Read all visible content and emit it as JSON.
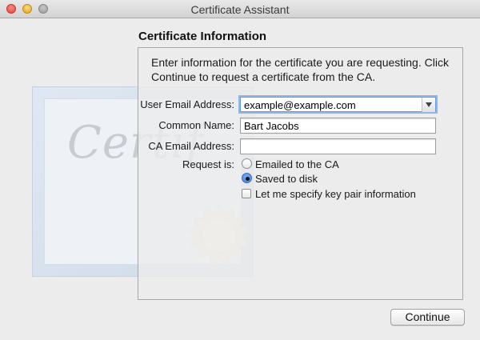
{
  "window": {
    "title": "Certificate Assistant"
  },
  "section": {
    "title": "Certificate Information"
  },
  "intro": "Enter information for the certificate you are requesting. Click Continue to request a certificate from the CA.",
  "form": {
    "user_email": {
      "label": "User Email Address:",
      "value": "example@example.com"
    },
    "common_name": {
      "label": "Common Name:",
      "value": "Bart Jacobs"
    },
    "ca_email": {
      "label": "CA Email Address:",
      "value": ""
    },
    "request": {
      "label": "Request is:",
      "options": [
        {
          "label": "Emailed to the CA",
          "checked": false
        },
        {
          "label": "Saved to disk",
          "checked": true
        }
      ],
      "key_pair": {
        "label": "Let me specify key pair information",
        "checked": false
      }
    }
  },
  "buttons": {
    "continue": "Continue"
  },
  "illustration": {
    "script_text": "Certif"
  }
}
